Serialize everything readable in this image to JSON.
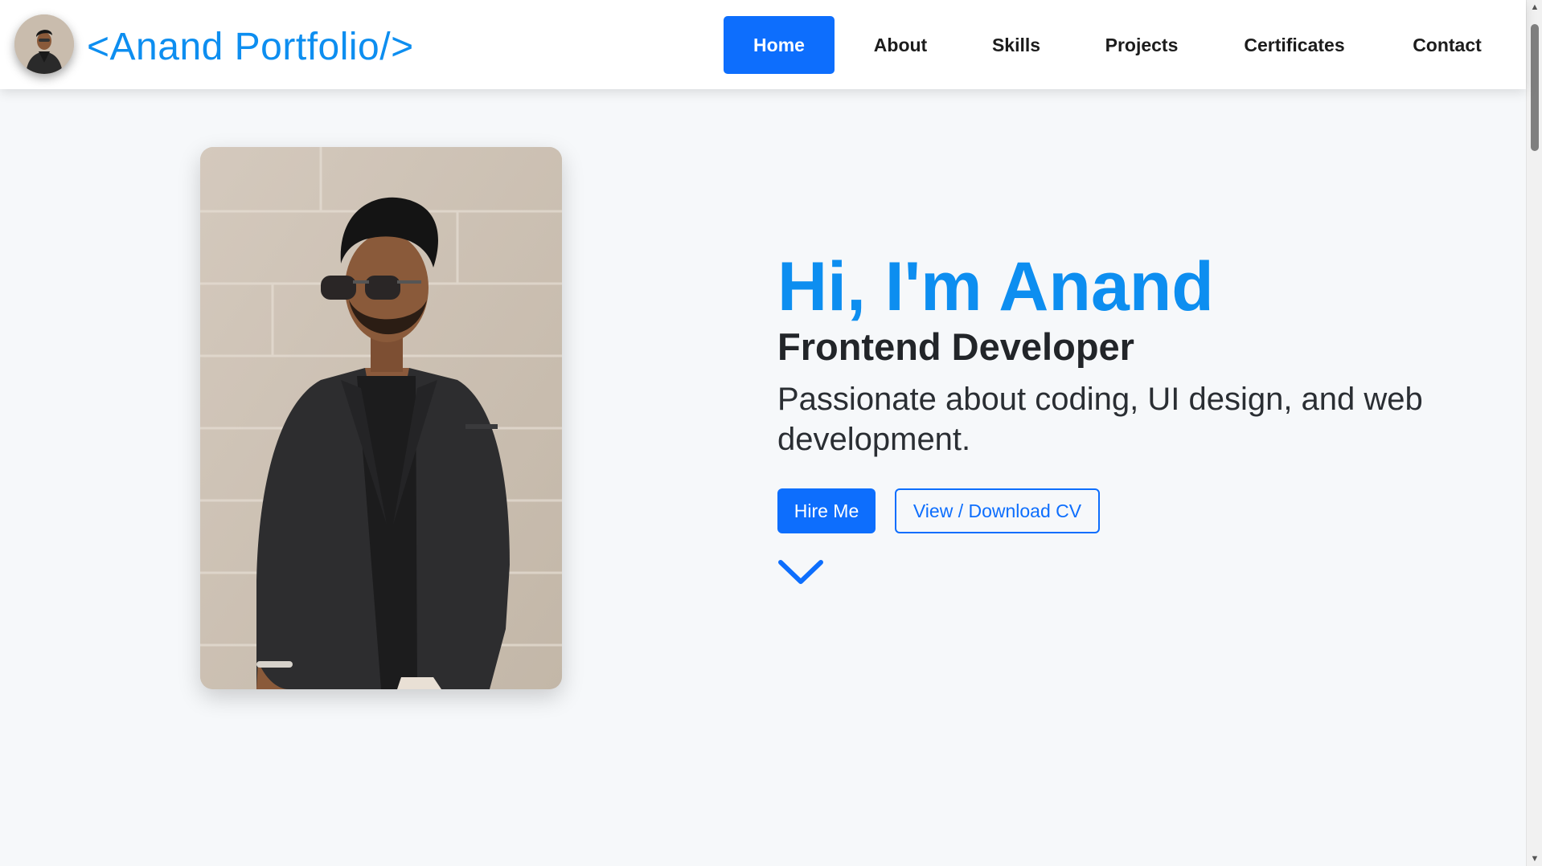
{
  "brand": {
    "title": "<Anand Portfolio/>"
  },
  "nav": {
    "items": [
      {
        "label": "Home",
        "active": true
      },
      {
        "label": "About"
      },
      {
        "label": "Skills"
      },
      {
        "label": "Projects"
      },
      {
        "label": "Certificates"
      },
      {
        "label": "Contact"
      }
    ]
  },
  "hero": {
    "greeting": "Hi, I'm Anand",
    "role": "Frontend Developer",
    "description": "Passionate about coding, UI design, and web development.",
    "primary_button": "Hire Me",
    "secondary_button": "View / Download CV"
  },
  "colors": {
    "accent": "#0d8ef0",
    "button_primary": "#0d6efd",
    "page_bg": "#f6f8fa",
    "navbar_bg": "#ffffff"
  },
  "icons": {
    "scroll_cue": "chevron-down-icon"
  }
}
